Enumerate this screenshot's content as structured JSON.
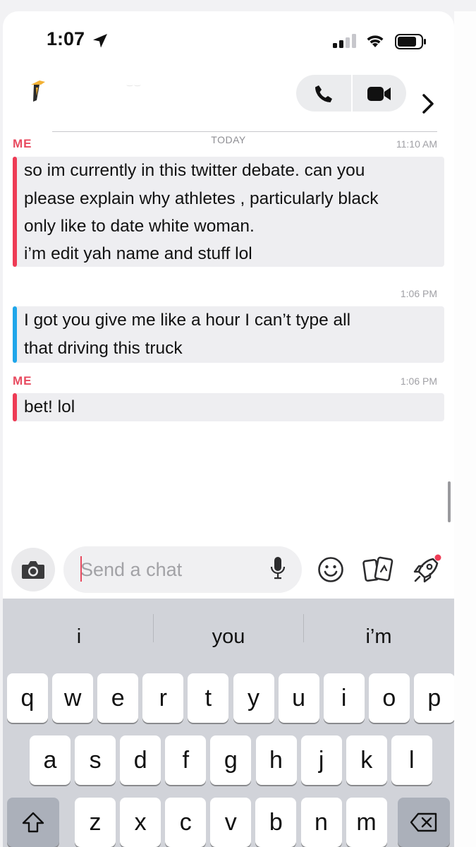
{
  "status_bar": {
    "time": "1:07"
  },
  "chat": {
    "date_label": "TODAY",
    "messages": [
      {
        "sender": "ME",
        "time": "11:10 AM",
        "lines": [
          "so im currently in this twitter debate. can you",
          "please explain why athletes , particularly black",
          "only like to date white woman.",
          "i’m edit yah name and stuff lol"
        ]
      },
      {
        "sender": "",
        "time": "1:06 PM",
        "lines": [
          "I got you give me like a hour I can’t type all",
          "that driving this truck"
        ]
      },
      {
        "sender": "ME",
        "time": "1:06 PM",
        "lines": [
          "bet! lol"
        ]
      }
    ]
  },
  "compose": {
    "placeholder": "Send a chat"
  },
  "keyboard": {
    "suggestions": [
      "i",
      "you",
      "i’m"
    ],
    "row1": [
      "q",
      "w",
      "e",
      "r",
      "t",
      "y",
      "u",
      "i",
      "o",
      "p"
    ],
    "row2": [
      "a",
      "s",
      "d",
      "f",
      "g",
      "h",
      "j",
      "k",
      "l"
    ],
    "row3": [
      "z",
      "x",
      "c",
      "v",
      "b",
      "n",
      "m"
    ]
  },
  "colors": {
    "me_accent": "#ee3b55",
    "friend_accent": "#1fa6ea",
    "bubble_bg": "#eeeef1",
    "keyboard_bg": "#d1d3d9"
  },
  "icons": {
    "location": "location-arrow-icon",
    "signal": "cellular-signal-icon",
    "wifi": "wifi-icon",
    "battery": "battery-icon",
    "call": "phone-icon",
    "video": "video-camera-icon",
    "more": "chevron-right-icon",
    "camera": "camera-icon",
    "mic": "microphone-icon",
    "emoji": "emoji-icon",
    "cards": "cards-icon",
    "rocket": "rocket-icon",
    "shift": "shift-icon",
    "delete": "backspace-icon"
  }
}
